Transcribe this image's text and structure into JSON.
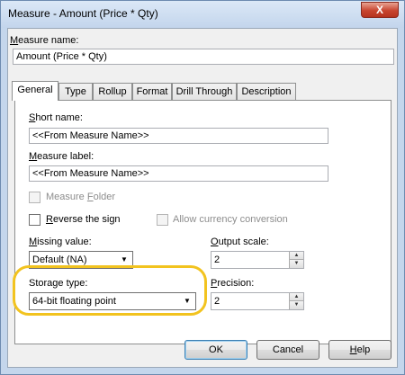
{
  "window": {
    "title": "Measure - Amount (Price * Qty)",
    "close_glyph": "X"
  },
  "measure_name": {
    "label_u": "M",
    "label_rest": "easure name:",
    "value": "Amount (Price * Qty)"
  },
  "tabs": [
    {
      "label": "General",
      "active": true
    },
    {
      "label": "Type"
    },
    {
      "label": "Rollup"
    },
    {
      "label": "Format"
    },
    {
      "label": "Drill Through"
    },
    {
      "label": "Description"
    }
  ],
  "general": {
    "short_name": {
      "label_u": "S",
      "label_rest": "hort name:",
      "value": "<<From Measure Name>>"
    },
    "measure_label": {
      "label_u": "M",
      "label_rest": "easure label:",
      "value": "<<From Measure Name>>"
    },
    "measure_folder": {
      "label_pre": "Measure ",
      "label_u": "F",
      "label_rest": "older",
      "checked": false,
      "enabled": false
    },
    "reverse_sign": {
      "label_u": "R",
      "label_rest": "everse the sign",
      "checked": false
    },
    "allow_currency": {
      "label": "Allow currency conversion",
      "checked": false,
      "enabled": false
    },
    "missing_value": {
      "label_u": "M",
      "label_rest": "issing value:",
      "value": "Default (NA)"
    },
    "output_scale": {
      "label_u": "O",
      "label_rest": "utput scale:",
      "value": "2"
    },
    "storage_type": {
      "label": "Storage type:",
      "value": "64-bit floating point"
    },
    "precision": {
      "label_pre": "",
      "label_u": "P",
      "label_rest": "recision:",
      "value": "2"
    }
  },
  "buttons": {
    "ok": "OK",
    "cancel": "Cancel",
    "help_u": "H",
    "help_rest": "elp"
  },
  "icons": {
    "dropdown": "chevron-down-icon",
    "spin_up": "spin-up-icon",
    "spin_down": "spin-down-icon"
  },
  "colors": {
    "highlight": "#f2c31f",
    "close_button": "#c8452f"
  }
}
